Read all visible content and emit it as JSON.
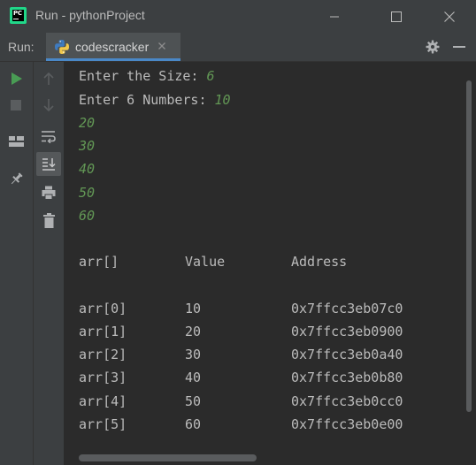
{
  "window": {
    "title": "Run - pythonProject",
    "logo_text": "PC"
  },
  "toolbar": {
    "run_label": "Run:",
    "tab_label": "codescracker"
  },
  "console": {
    "prompt_size": "Enter the Size: ",
    "input_size": "6",
    "prompt_numbers": "Enter 6 Numbers: ",
    "inputs": [
      "10",
      "20",
      "30",
      "40",
      "50",
      "60"
    ],
    "headers": [
      "arr[]",
      "Value",
      "Address"
    ],
    "rows": [
      [
        "arr[0]",
        "10",
        "0x7ffcc3eb07c0"
      ],
      [
        "arr[1]",
        "20",
        "0x7ffcc3eb0900"
      ],
      [
        "arr[2]",
        "30",
        "0x7ffcc3eb0a40"
      ],
      [
        "arr[3]",
        "40",
        "0x7ffcc3eb0b80"
      ],
      [
        "arr[4]",
        "50",
        "0x7ffcc3eb0cc0"
      ],
      [
        "arr[5]",
        "60",
        "0x7ffcc3eb0e00"
      ]
    ]
  },
  "colors": {
    "input_text": "#629755",
    "output_text": "#bbbbbb",
    "run_green": "#499c54",
    "tab_underline": "#4a88c7"
  },
  "icons": [
    "pycharm-logo-icon",
    "minimize-icon",
    "maximize-icon",
    "close-icon",
    "python-icon",
    "tab-close-icon",
    "gear-icon",
    "minus-icon",
    "run-icon",
    "stop-icon",
    "layout-icon",
    "pin-icon",
    "arrow-up-icon",
    "arrow-down-icon",
    "soft-wrap-icon",
    "scroll-to-end-icon",
    "print-icon",
    "trash-icon"
  ]
}
